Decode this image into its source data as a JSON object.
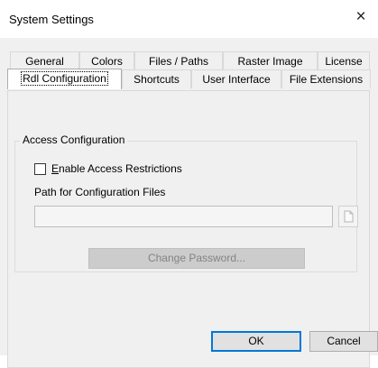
{
  "window": {
    "title": "System Settings",
    "close_glyph": "×"
  },
  "tabs_back_row": [
    {
      "label": "General"
    },
    {
      "label": "Colors"
    },
    {
      "label": "Files / Paths"
    },
    {
      "label": "Raster Image"
    },
    {
      "label": "License"
    }
  ],
  "tabs_front_row": [
    {
      "label": "Rdl Configuration",
      "selected": true
    },
    {
      "label": "Shortcuts"
    },
    {
      "label": "User Interface"
    },
    {
      "label": "File Extensions"
    }
  ],
  "access_group": {
    "legend": "Access Configuration",
    "enable_checkbox": {
      "mnemonic": "E",
      "label_rest": "nable Access Restrictions",
      "checked": false
    },
    "path_label": "Path for Configuration Files",
    "path_value": "",
    "browse_icon": "file-icon"
  },
  "change_password_label": "Change Password...",
  "footer": {
    "ok_label": "OK",
    "cancel_label": "Cancel"
  }
}
